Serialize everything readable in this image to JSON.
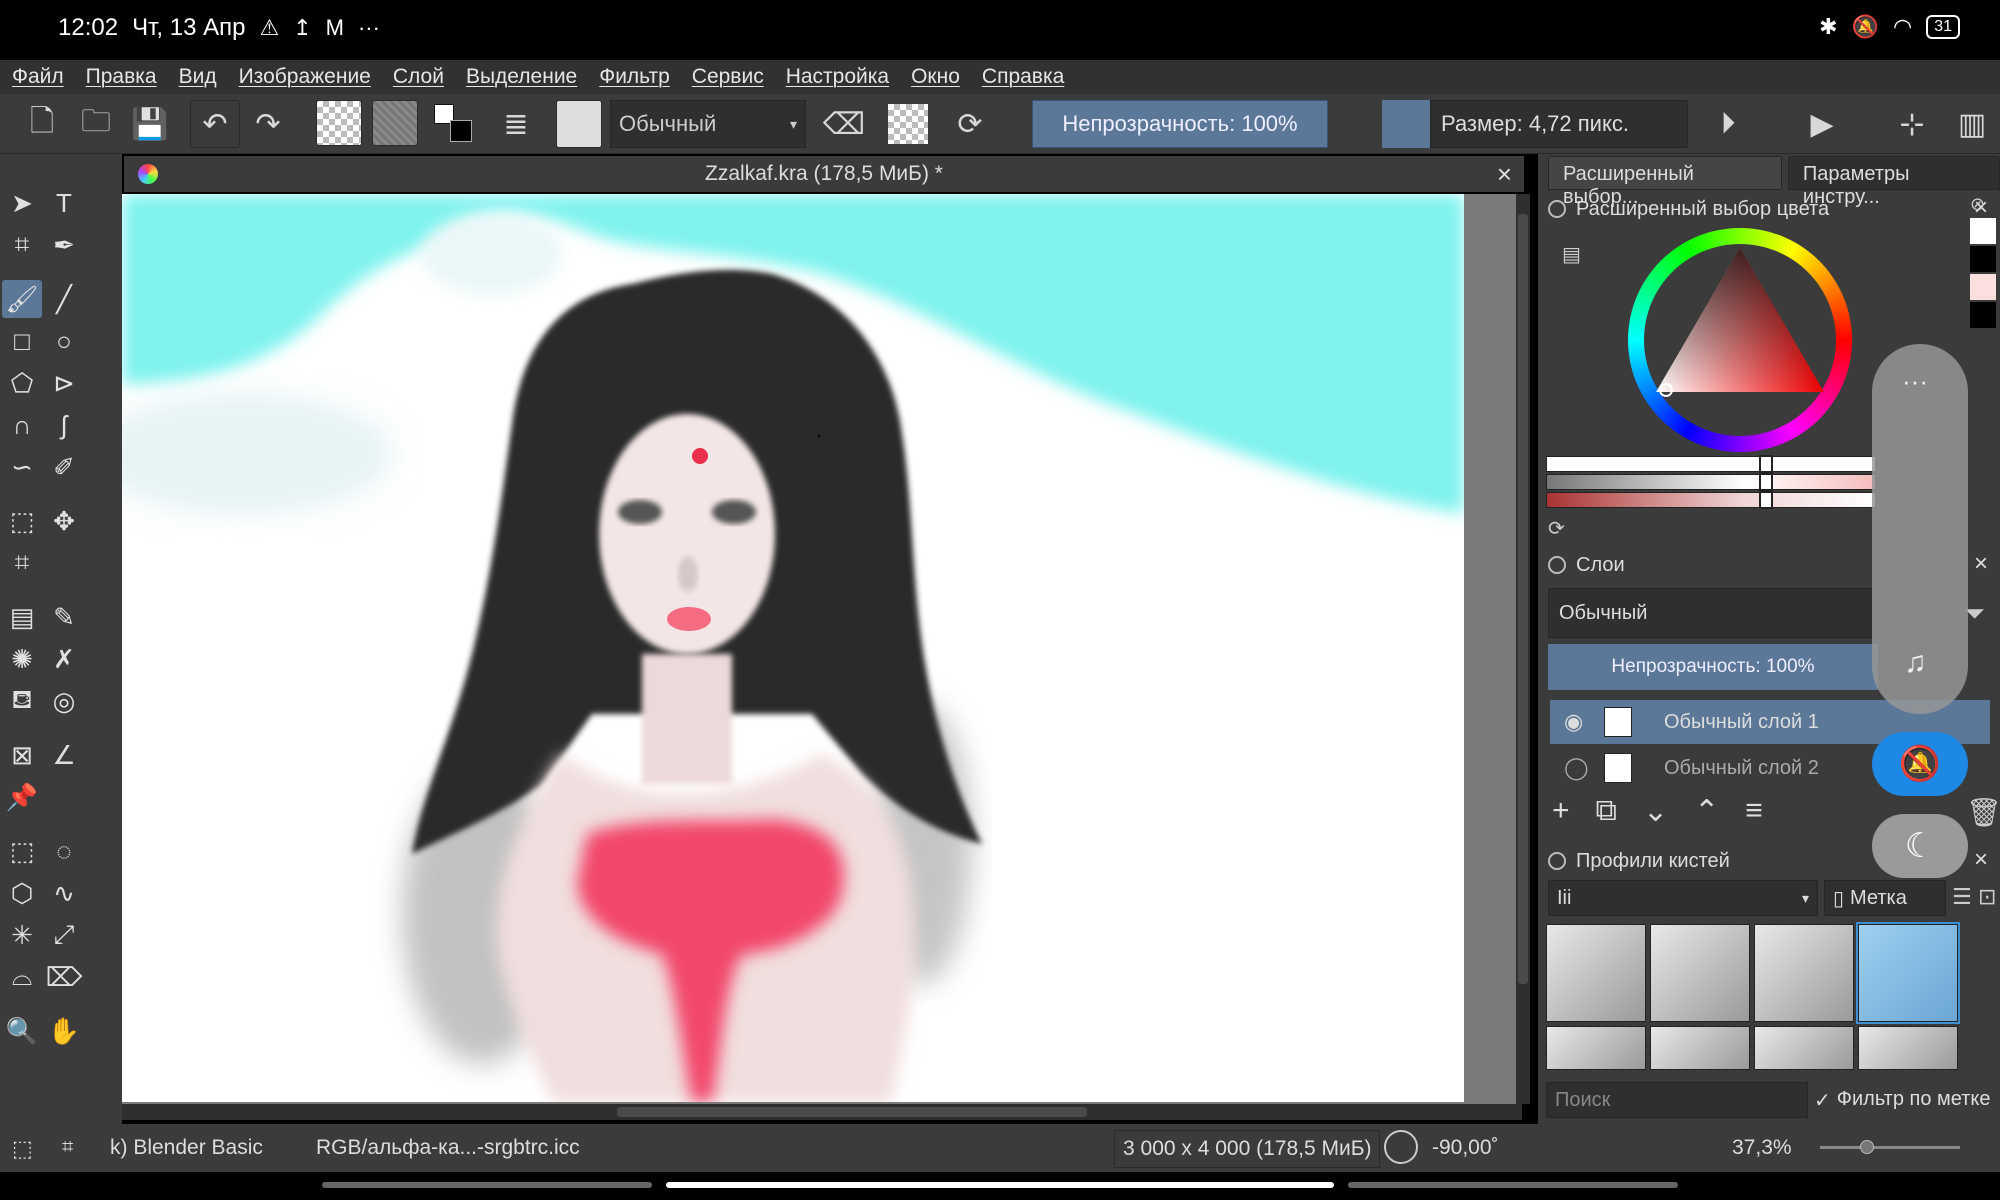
{
  "status_bar": {
    "time": "12:02",
    "date": "Чт, 13 Апр",
    "battery": "31"
  },
  "menu": [
    "Файл",
    "Правка",
    "Вид",
    "Изображение",
    "Слой",
    "Выделение",
    "Фильтр",
    "Сервис",
    "Настройка",
    "Окно",
    "Справка"
  ],
  "toolbar": {
    "blend_mode": "Обычный",
    "opacity": "Непрозрачность: 100%",
    "size": "Размер: 4,72 пикс."
  },
  "document": {
    "title": "Zzalkaf.kra (178,5 МиБ)  *"
  },
  "docker": {
    "tabs": [
      "Расширенный выбор...",
      "Параметры инстру..."
    ],
    "color_panel_title": "Расширенный выбор цвета",
    "layers_title": "Слои",
    "layers_blend_mode": "Обычный",
    "layers_opacity": "Непрозрачность:  100%",
    "layers": [
      "Обычный слой 1",
      "Обычный слой 2"
    ],
    "brushes_title": "Профили кистей",
    "brush_tag": "Iii",
    "tag_button": "Метка",
    "search_placeholder": "Поиск",
    "filter_by_tag": "Фильтр по метке"
  },
  "bottom": {
    "brush_name": "k) Blender Basic",
    "color_profile": "RGB/альфа-ка...-srgbtrc.icc",
    "dimensions": "3 000 x 4 000 (178,5 МиБ)",
    "rotation": "-90,00˚",
    "zoom": "37,3%"
  },
  "colors": {
    "accent": "#5b7899",
    "panel_bg": "#3b3b3b",
    "sky": "#7ff3ee"
  }
}
